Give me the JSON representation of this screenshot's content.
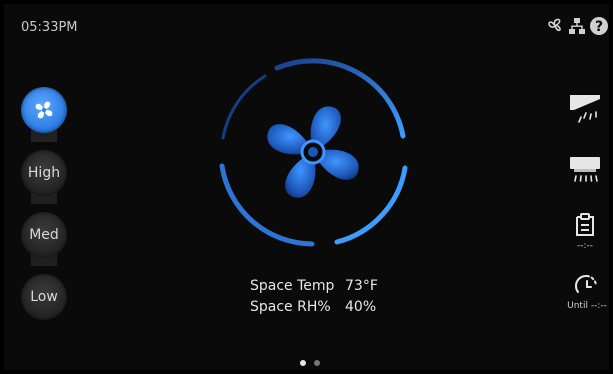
{
  "status_bar": {
    "time": "05:33PM"
  },
  "top_icons": [
    "fan-status-icon",
    "network-icon",
    "help-icon"
  ],
  "fan_speed": {
    "options": [
      {
        "label": "",
        "icon": "fan-auto-icon",
        "selected": true
      },
      {
        "label": "High",
        "selected": false
      },
      {
        "label": "Med",
        "selected": false
      },
      {
        "label": "Low",
        "selected": false
      }
    ]
  },
  "readouts": {
    "space_temp_label": "Space Temp",
    "space_temp_value": "73°F",
    "space_rh_label": "Space RH%",
    "space_rh_value": "40%"
  },
  "right_panel": {
    "louver_icon": "louver-up-icon",
    "unit_icon": "unit-airflow-icon",
    "schedule_label": "--:--",
    "timer_label": "Until --:--"
  },
  "pager": {
    "pages": 2,
    "active": 1
  },
  "colors": {
    "accent": "#2f8cff",
    "background": "#0a0a0a",
    "pill": "#262626"
  }
}
